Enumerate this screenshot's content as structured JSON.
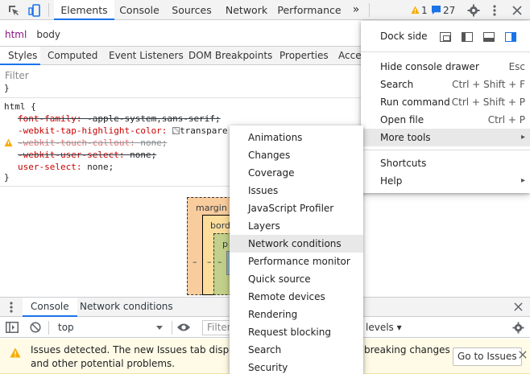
{
  "toolbar": {
    "tabs": [
      "Elements",
      "Console",
      "Sources",
      "Network",
      "Performance"
    ],
    "more_tabs": "»",
    "warning_count": "1",
    "message_count": "27"
  },
  "breadcrumb": [
    "html",
    "body"
  ],
  "styles_tabs": [
    "Styles",
    "Computed",
    "Event Listeners",
    "DOM Breakpoints",
    "Properties",
    "Acce"
  ],
  "filter": {
    "placeholder": "Filter"
  },
  "css": {
    "selector": "html {",
    "close": "}",
    "rules": [
      {
        "prop": "font-family:",
        "value": " -apple-system,sans-serif;"
      },
      {
        "prop": "-webkit-tap-highlight-color:",
        "value": "transpare"
      },
      {
        "prop": "-webkit-touch-callout:",
        "value": " none;"
      },
      {
        "prop": "-webkit-user-select:",
        "value": " none;"
      },
      {
        "prop": "user-select:",
        "value": " none;"
      }
    ]
  },
  "box_model": {
    "margin_label": "margin",
    "border_label": "bord",
    "padding_label": "p",
    "dash": "–"
  },
  "drawer": {
    "tabs": [
      "Console",
      "Network conditions"
    ],
    "context": "top",
    "filter_placeholder": "Filter",
    "levels": "levels ▾",
    "issues_text_1": "Issues detected. The new Issues tab displays in",
    "issues_text_1b": "breaking changes",
    "issues_text_2": "and other potential problems.",
    "issues_button": "Go to Issues"
  },
  "main_menu": {
    "dock_label": "Dock side",
    "items": [
      {
        "label": "Hide console drawer",
        "shortcut": "Esc"
      },
      {
        "label": "Search",
        "shortcut": "Ctrl + Shift + F"
      },
      {
        "label": "Run command",
        "shortcut": "Ctrl + Shift + P"
      },
      {
        "label": "Open file",
        "shortcut": "Ctrl + P"
      },
      {
        "label": "More tools",
        "shortcut": "▸"
      }
    ],
    "items2": [
      {
        "label": "Shortcuts"
      },
      {
        "label": "Help",
        "shortcut": "▸"
      }
    ]
  },
  "tools_menu": {
    "items": [
      "Animations",
      "Changes",
      "Coverage",
      "Issues",
      "JavaScript Profiler",
      "Layers",
      "Network conditions",
      "Performance monitor",
      "Quick source",
      "Remote devices",
      "Rendering",
      "Request blocking",
      "Search",
      "Security"
    ],
    "highlighted": "Network conditions"
  },
  "colors": {
    "accent": "#1a73e8",
    "warning": "#f9ab00"
  }
}
